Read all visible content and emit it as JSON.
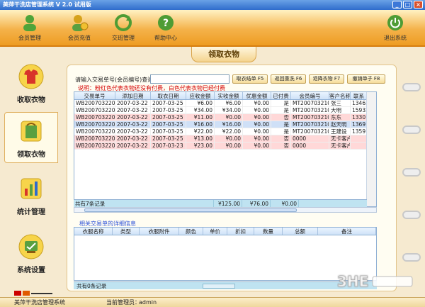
{
  "window": {
    "title": "美萍干洗店管理系统 V 2.0 试用版"
  },
  "toolbar": {
    "items": [
      {
        "label": "会员管理"
      },
      {
        "label": "会员充值"
      },
      {
        "label": "交班管理"
      },
      {
        "label": "帮助中心"
      },
      {
        "label": "退出系统"
      }
    ]
  },
  "page": {
    "title": "领取衣物"
  },
  "nav": {
    "items": [
      {
        "label": "收取衣物"
      },
      {
        "label": "领取衣物"
      },
      {
        "label": "统计管理"
      },
      {
        "label": "系统设置"
      }
    ]
  },
  "search": {
    "label": "请输入交易单号(会员编号)查询",
    "value": "",
    "buttons": [
      "取衣结单 F5",
      "返回重洗 F6",
      "退降衣物 F7",
      "撤销单子 F8"
    ]
  },
  "note": "说明：粉红色代表衣物还没有付费，白色代表衣物已经付费",
  "table": {
    "columns": [
      "交易单号",
      "添加日期",
      "取衣日期",
      "应收金额",
      "实收金额",
      "优惠金额",
      "已付费",
      "会员编号",
      "客户名称",
      "联系"
    ],
    "rows": [
      [
        "WB20070322009",
        "2007-03-22",
        "2007-03-25",
        "¥6.00",
        "¥6.00",
        "¥0.00",
        "是",
        "MT20070321001",
        "张三",
        "134658"
      ],
      [
        "WB20070322008",
        "2007-03-22",
        "2007-03-25",
        "¥34.00",
        "¥34.00",
        "¥0.00",
        "是",
        "MT20070321007",
        "大明",
        "159321"
      ],
      [
        "WB20070322005",
        "2007-03-22",
        "2007-03-25",
        "¥11.00",
        "¥0.00",
        "¥0.00",
        "否",
        "MT20070321003",
        "东东",
        "133015"
      ],
      [
        "WB20070322004",
        "2007-03-22",
        "2007-03-25",
        "¥16.00",
        "¥16.00",
        "¥0.00",
        "是",
        "MT20070321005",
        "赵天明",
        "136914"
      ],
      [
        "WB20070322003",
        "2007-03-22",
        "2007-03-25",
        "¥22.00",
        "¥22.00",
        "¥0.00",
        "是",
        "MT20070321002",
        "王建设",
        "135914"
      ],
      [
        "WB20070322002",
        "2007-03-22",
        "2007-03-25",
        "¥13.00",
        "¥0.00",
        "¥0.00",
        "否",
        "0000",
        "无卡客户",
        ""
      ],
      [
        "WB20070322001",
        "2007-03-22",
        "2007-03-23",
        "¥23.00",
        "¥0.00",
        "¥0.00",
        "否",
        "0000",
        "无卡客户",
        ""
      ]
    ],
    "pink_rows": [
      2,
      5,
      6
    ],
    "selected_row": 3,
    "summary": {
      "count": "共有7条记录",
      "receivable": "¥125.00",
      "received": "¥76.00",
      "discount": "¥0.00"
    }
  },
  "detail": {
    "title": "相关交易单的详细信息",
    "columns": [
      "衣服名称",
      "类型",
      "衣服附件",
      "颜色",
      "单价",
      "折扣",
      "数量",
      "总额",
      "备注"
    ],
    "summary": "共有0条记录"
  },
  "status": {
    "system": "美萍干洗店管理系统",
    "operator_label": "当前管理员：",
    "operator": "admin"
  },
  "watermark": "3HE当游网",
  "logo": "美萍软件",
  "colors": {
    "toolbar": "#f4b24a",
    "pink_row": "#ffd8d8",
    "note": "#d40000",
    "summary_bg": "#bfe3f1"
  }
}
